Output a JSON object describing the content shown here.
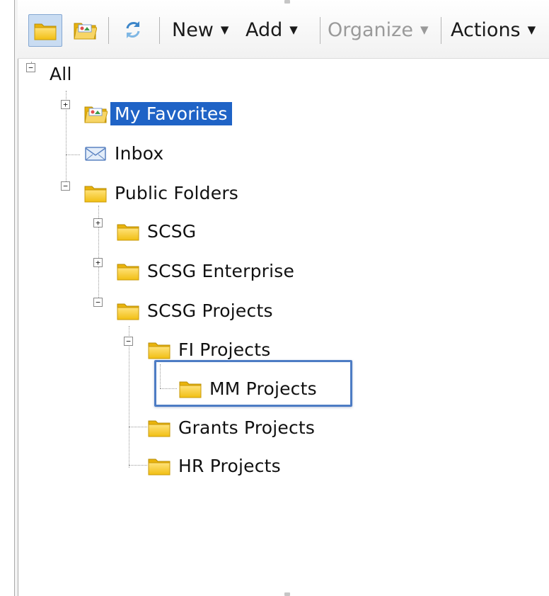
{
  "toolbar": {
    "new_label": "New",
    "add_label": "Add",
    "organize_label": "Organize",
    "actions_label": "Actions",
    "buttons": [
      {
        "icon": "folder-view-icon",
        "selected": true
      },
      {
        "icon": "favorites-view-icon",
        "selected": false
      },
      {
        "icon": "refresh-icon",
        "selected": false
      }
    ]
  },
  "tree": {
    "root": {
      "label": "All",
      "expanded": true
    },
    "items": [
      {
        "label": "My Favorites",
        "icon": "favorites-folder-icon",
        "selected": true,
        "expandable": true,
        "expanded": false
      },
      {
        "label": "Inbox",
        "icon": "inbox-icon",
        "selected": false,
        "expandable": false
      },
      {
        "label": "Public Folders",
        "icon": "folder-icon",
        "selected": false,
        "expandable": true,
        "expanded": true
      },
      {
        "label": "SCSG",
        "icon": "folder-icon",
        "selected": false,
        "expandable": true,
        "expanded": false
      },
      {
        "label": "SCSG Enterprise",
        "icon": "folder-icon",
        "selected": false,
        "expandable": true,
        "expanded": false
      },
      {
        "label": "SCSG Projects",
        "icon": "folder-icon",
        "selected": false,
        "expandable": true,
        "expanded": true
      },
      {
        "label": "FI Projects",
        "icon": "folder-icon",
        "selected": false,
        "expandable": true,
        "expanded": true
      },
      {
        "label": "MM Projects",
        "icon": "folder-icon",
        "selected": false,
        "expandable": false,
        "highlighted": true
      },
      {
        "label": "Grants Projects",
        "icon": "folder-icon",
        "selected": false,
        "expandable": false
      },
      {
        "label": "HR Projects",
        "icon": "folder-icon",
        "selected": false,
        "expandable": false
      }
    ]
  },
  "colors": {
    "selection_bg": "#1f63c6",
    "highlight_border": "#4d7cc4",
    "folder_yellow": "#f7cf2c"
  }
}
